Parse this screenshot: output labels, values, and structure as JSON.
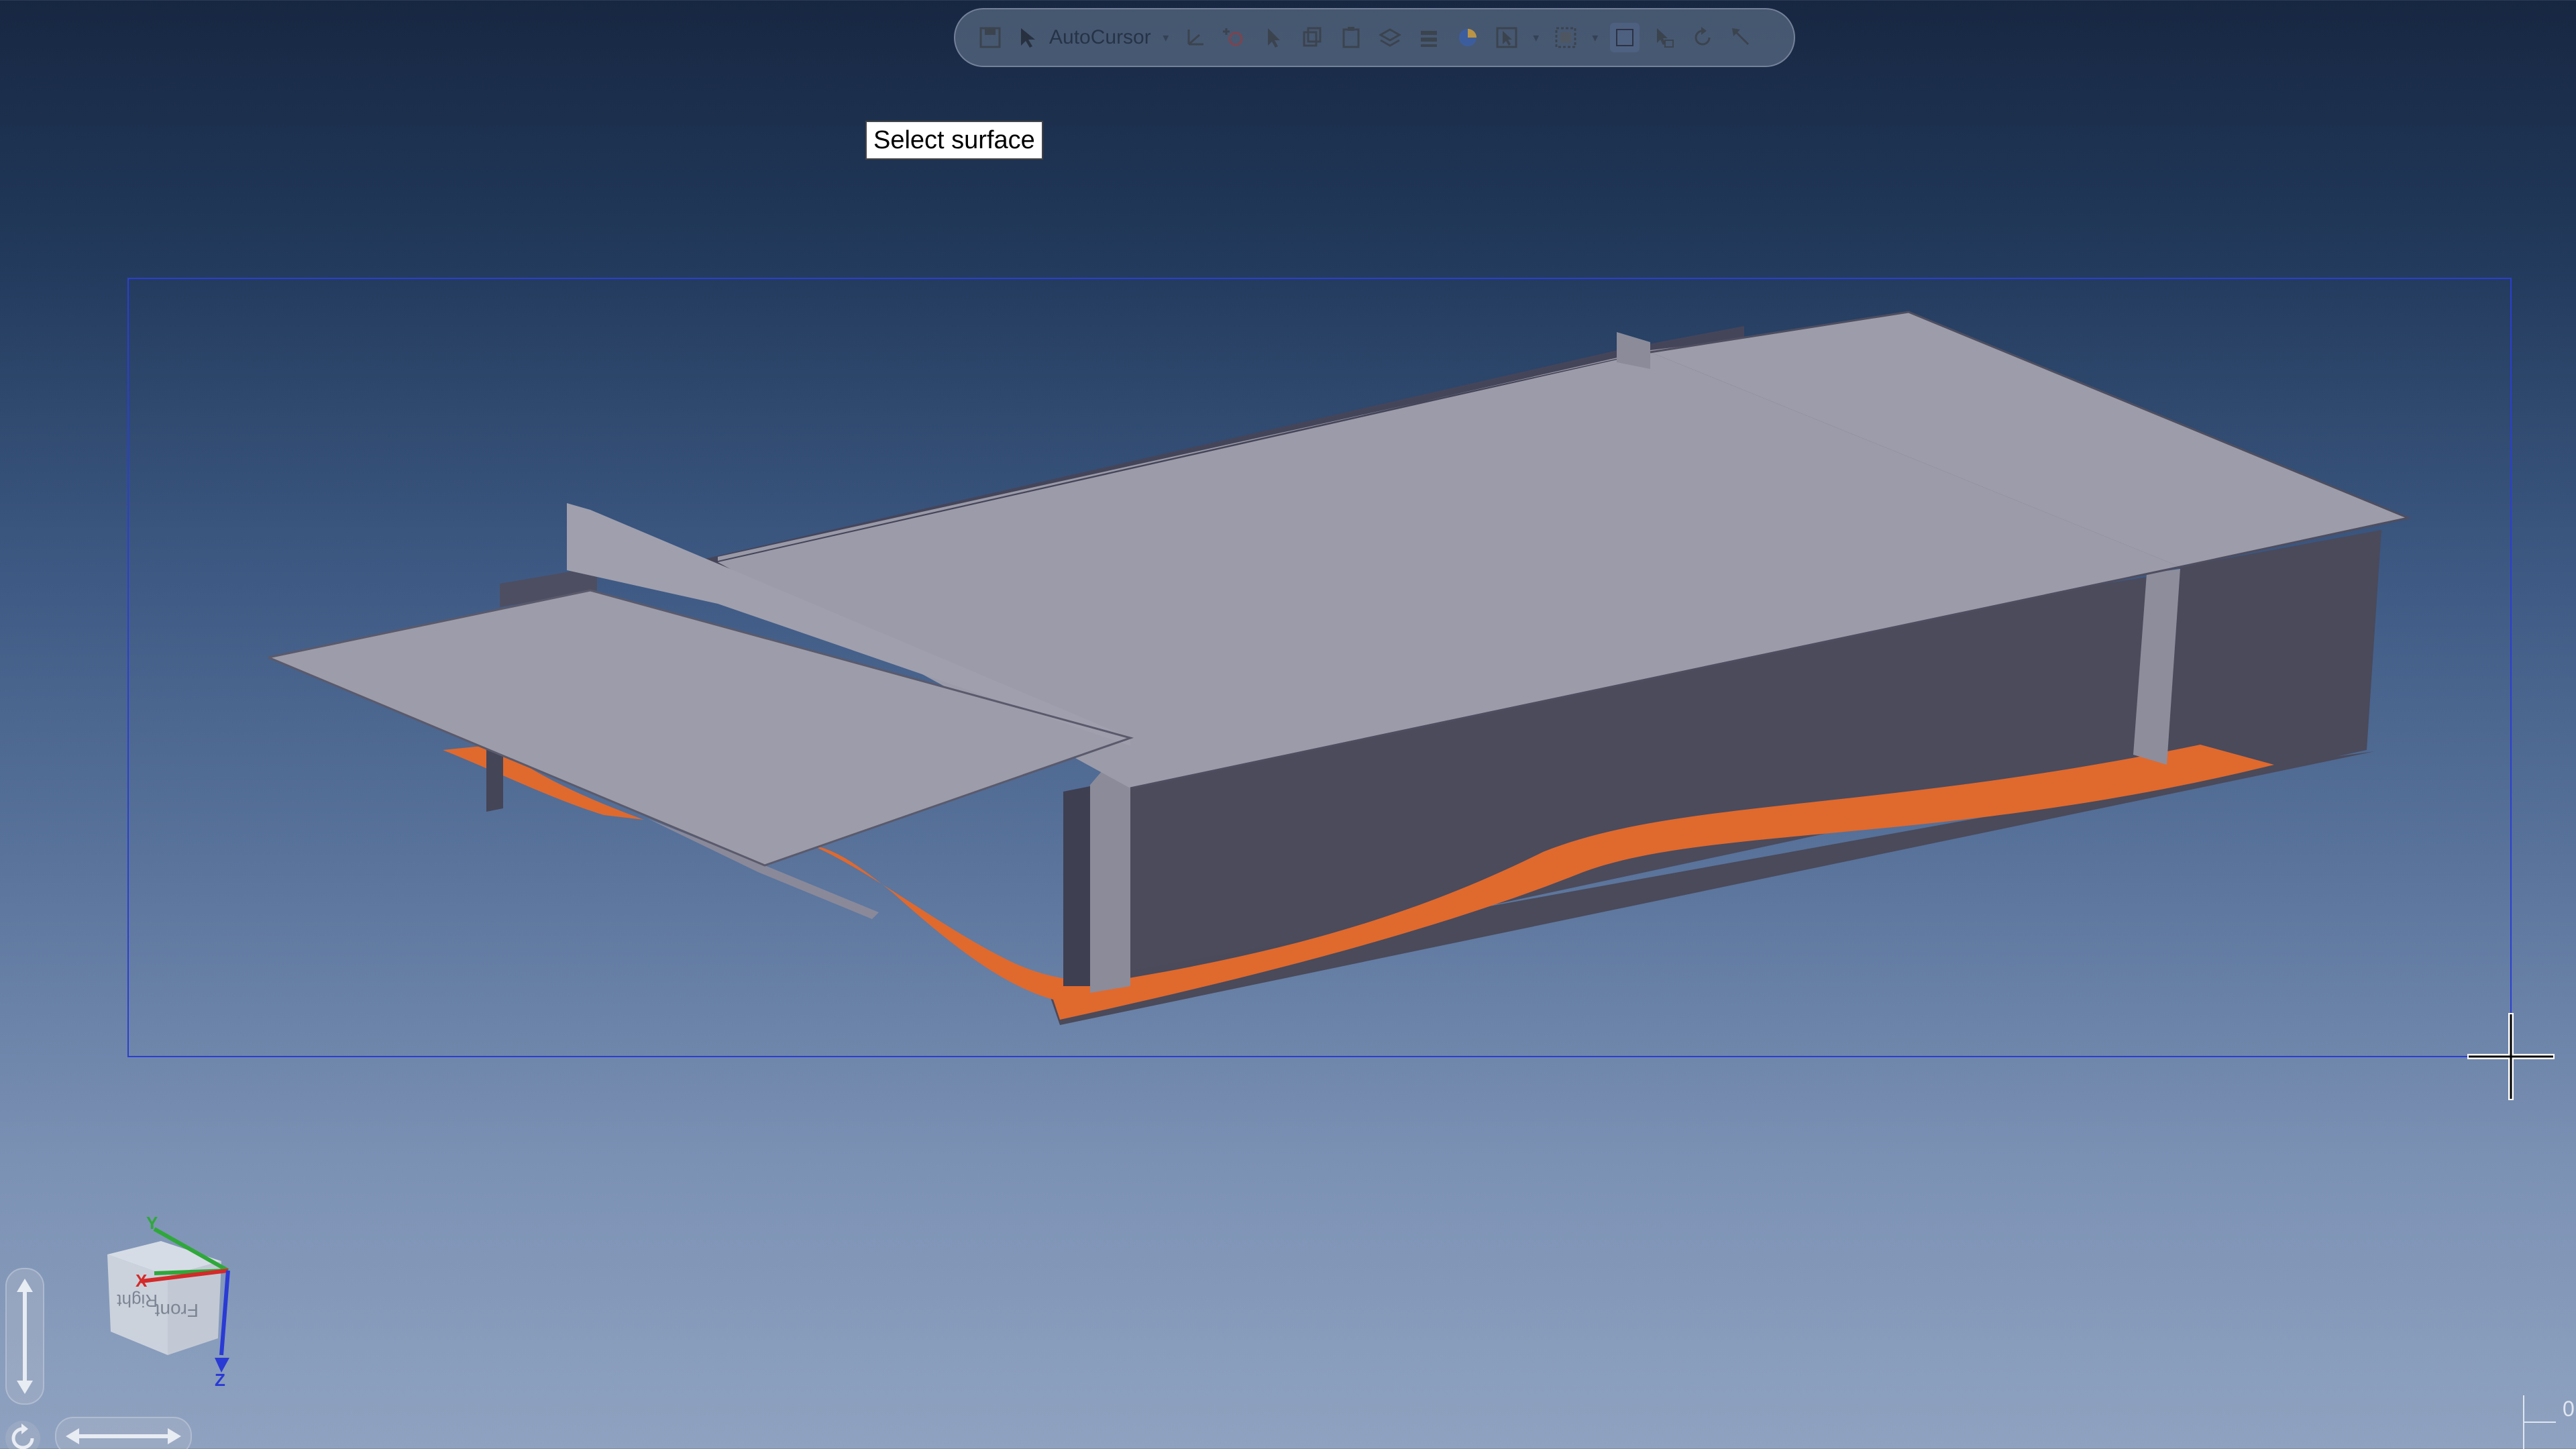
{
  "toolbar": {
    "autocursor_label": "AutoCursor",
    "icons": [
      "save-icon",
      "cursor-icon",
      "coordinate-system-icon",
      "add-point-icon",
      "select-pointer-icon",
      "copy-icon",
      "paste-icon",
      "layer-icon",
      "layers-stack-icon",
      "shaded-sphere-icon",
      "select-mode-icon",
      "grid-select-icon",
      "view-toggle-icon",
      "undo-icon",
      "rotate-view-icon",
      "tool-arrow-icon"
    ]
  },
  "tooltip": {
    "text": "Select surface"
  },
  "viewcube": {
    "axis_y": "Y",
    "axis_x": "X",
    "axis_z": "Z",
    "face_front": "Front",
    "face_right": "Right"
  },
  "corner": {
    "text": "0"
  },
  "colors": {
    "surface_top": "#9c9ba9",
    "surface_dark": "#4b4b5b",
    "highlight_orange": "#e0692e",
    "selection_blue": "#2b3fd0"
  }
}
